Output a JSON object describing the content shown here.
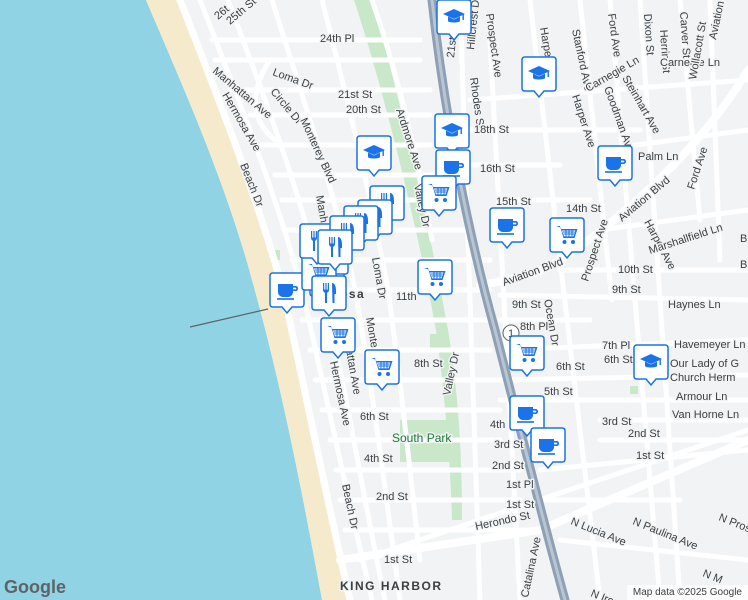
{
  "map": {
    "attribution": "Map data ©2025 Google",
    "logo": "Google",
    "colors": {
      "ocean": "#8fd3e4",
      "beach": "#f5eacb",
      "land": "#f1f3f4",
      "road": "#ffffff",
      "highway": "#8ea0b5",
      "park": "#c9e7c9",
      "pin": "#1a73e8"
    },
    "labels": [
      {
        "id": "26th-st",
        "text": "26t"
      },
      {
        "id": "25th-st",
        "text": "25th St"
      },
      {
        "id": "24th-pl",
        "text": "24th Pl"
      },
      {
        "id": "loma-dr-n",
        "text": "Loma Dr"
      },
      {
        "id": "manhattan-ave-n",
        "text": "Manhattan Ave"
      },
      {
        "id": "circle-dr",
        "text": "Circle Dr"
      },
      {
        "id": "monterey-blvd",
        "text": "Monterey Blvd"
      },
      {
        "id": "21st-st",
        "text": "21st St"
      },
      {
        "id": "20th-st",
        "text": "20th St"
      },
      {
        "id": "hermosa-ave-n",
        "text": "Hermosa Ave"
      },
      {
        "id": "beach-dr-n",
        "text": "Beach Dr"
      },
      {
        "id": "ardmore-ave",
        "text": "Ardmore Ave"
      },
      {
        "id": "valley-dr-n",
        "text": "Valley Dr"
      },
      {
        "id": "manhattan-ave-mid",
        "text": "Manh"
      },
      {
        "id": "loma-dr-s",
        "text": "Loma Dr"
      },
      {
        "id": "11th-st",
        "text": "11th"
      },
      {
        "id": "hermosa-city",
        "text": "osa"
      },
      {
        "id": "monterey-s",
        "text": "Monte"
      },
      {
        "id": "manhattan-ave-s",
        "text": "attan Ave"
      },
      {
        "id": "hermosa-ave-s",
        "text": "Hermosa Ave"
      },
      {
        "id": "8th-st",
        "text": "8th St"
      },
      {
        "id": "6th-st",
        "text": "6th St"
      },
      {
        "id": "4th-st",
        "text": "4th St"
      },
      {
        "id": "2nd-st",
        "text": "2nd St"
      },
      {
        "id": "1st-st",
        "text": "1st St"
      },
      {
        "id": "beach-dr-s",
        "text": "Beach Dr"
      },
      {
        "id": "south-park",
        "text": "South Park"
      },
      {
        "id": "valley-dr-s",
        "text": "Valley Dr"
      },
      {
        "id": "king-harbor",
        "text": "KING HARBOR"
      },
      {
        "id": "prospect-ave-n",
        "text": "Prospect Ave"
      },
      {
        "id": "21st-st-e",
        "text": "21st St"
      },
      {
        "id": "hillcrest-dr",
        "text": "Hillcrest Dr"
      },
      {
        "id": "rhodes-st",
        "text": "Rhodes St"
      },
      {
        "id": "18th-st",
        "text": "18th St"
      },
      {
        "id": "16th-st",
        "text": "16th St"
      },
      {
        "id": "14th-st",
        "text": "14th St"
      },
      {
        "id": "15th-st",
        "text": "15th St"
      },
      {
        "id": "harper-ave-n",
        "text": "Harper Ave"
      },
      {
        "id": "stanford-ave",
        "text": "Stanford Ave"
      },
      {
        "id": "ford-ave-n",
        "text": "Ford Ave"
      },
      {
        "id": "dixon-st",
        "text": "Dixon St"
      },
      {
        "id": "carver-st",
        "text": "Carver St"
      },
      {
        "id": "herrin-st",
        "text": "Herrin St"
      },
      {
        "id": "aviation-blvd-ne",
        "text": "Aviation Blvd"
      },
      {
        "id": "carnegie-ln-n",
        "text": "Carnegie Ln"
      },
      {
        "id": "carnegie-ln",
        "text": "Carnegie Ln"
      },
      {
        "id": "steinhart-ave",
        "text": "Steinhart Ave"
      },
      {
        "id": "goodman-ave",
        "text": "Goodman Ave"
      },
      {
        "id": "harper-ave-m",
        "text": "Harper Ave"
      },
      {
        "id": "wollacott-st",
        "text": "Wollacott St"
      },
      {
        "id": "palm-ln",
        "text": "Palm Ln"
      },
      {
        "id": "aviation-blvd-e",
        "text": "Aviation Blvd"
      },
      {
        "id": "ford-ave-e",
        "text": "Ford Ave"
      },
      {
        "id": "harper-ave-s",
        "text": "Harper Ave"
      },
      {
        "id": "marshallfield-ln",
        "text": "Marshallfield Ln"
      },
      {
        "id": "aviation-blvd-w",
        "text": "Aviation Blvd"
      },
      {
        "id": "10th-st",
        "text": "10th St"
      },
      {
        "id": "9th-st-e",
        "text": "9th St"
      },
      {
        "id": "9th-st",
        "text": "9th St"
      },
      {
        "id": "prospect-ave-s",
        "text": "Prospect Ave"
      },
      {
        "id": "ocean-dr",
        "text": "Ocean Dr"
      },
      {
        "id": "8th-pl",
        "text": "8th Pl"
      },
      {
        "id": "haynes-ln",
        "text": "Haynes Ln"
      },
      {
        "id": "havemeyer-ln",
        "text": "Havemeyer Ln"
      },
      {
        "id": "7th-pl",
        "text": "7th Pl"
      },
      {
        "id": "6th-st-e",
        "text": "6th St"
      },
      {
        "id": "6th-st-m",
        "text": "6th St"
      },
      {
        "id": "5th-st",
        "text": "5th St"
      },
      {
        "id": "church-1",
        "text": "Our Lady of G"
      },
      {
        "id": "church-2",
        "text": "Church Herm"
      },
      {
        "id": "armour-ln",
        "text": "Armour Ln"
      },
      {
        "id": "van-horne-ln",
        "text": "Van Horne Ln"
      },
      {
        "id": "3rd-st-e",
        "text": "3rd St"
      },
      {
        "id": "2nd-st-e",
        "text": "2nd St"
      },
      {
        "id": "1st-st-e",
        "text": "1st St"
      },
      {
        "id": "4th-st-m",
        "text": "4th"
      },
      {
        "id": "3rd-st",
        "text": "3rd St"
      },
      {
        "id": "2nd-st-m",
        "text": "2nd St"
      },
      {
        "id": "1st-pl",
        "text": "1st Pl"
      },
      {
        "id": "1st-st-m",
        "text": "1st St"
      },
      {
        "id": "herondo-st",
        "text": "Herondo St"
      },
      {
        "id": "n-paulina-ave",
        "text": "N Paulina Ave"
      },
      {
        "id": "n-pros",
        "text": "N Pros"
      },
      {
        "id": "n-lucia-ave",
        "text": "N Lucia Ave"
      },
      {
        "id": "catalina-ave",
        "text": "Catalina Ave"
      },
      {
        "id": "n-irena",
        "text": "N Iren"
      },
      {
        "id": "n-m",
        "text": "N M"
      },
      {
        "id": "route-1",
        "text": "1"
      },
      {
        "id": "bl",
        "text": "Bl"
      },
      {
        "id": "b",
        "text": "B"
      }
    ],
    "markers": [
      {
        "id": "school-1",
        "icon": "school-icon"
      },
      {
        "id": "school-2",
        "icon": "school-icon"
      },
      {
        "id": "school-3",
        "icon": "school-icon"
      },
      {
        "id": "school-4",
        "icon": "school-icon"
      },
      {
        "id": "school-5",
        "icon": "school-icon"
      },
      {
        "id": "cafe-1",
        "icon": "coffee-icon"
      },
      {
        "id": "cafe-2",
        "icon": "coffee-icon"
      },
      {
        "id": "cafe-3",
        "icon": "coffee-icon"
      },
      {
        "id": "cafe-4",
        "icon": "coffee-icon"
      },
      {
        "id": "cafe-5",
        "icon": "coffee-icon"
      },
      {
        "id": "cafe-6",
        "icon": "coffee-icon"
      },
      {
        "id": "cafe-7",
        "icon": "coffee-icon"
      },
      {
        "id": "shop-1",
        "icon": "cart-icon"
      },
      {
        "id": "shop-2",
        "icon": "cart-icon"
      },
      {
        "id": "shop-3",
        "icon": "cart-icon"
      },
      {
        "id": "shop-4",
        "icon": "cart-icon"
      },
      {
        "id": "shop-5",
        "icon": "cart-icon"
      },
      {
        "id": "shop-6",
        "icon": "cart-icon"
      },
      {
        "id": "shop-7",
        "icon": "cart-icon"
      },
      {
        "id": "shop-8",
        "icon": "cart-icon"
      },
      {
        "id": "food-1",
        "icon": "utensils-icon"
      },
      {
        "id": "food-2",
        "icon": "utensils-icon"
      },
      {
        "id": "food-3",
        "icon": "utensils-icon"
      },
      {
        "id": "food-4",
        "icon": "utensils-icon"
      },
      {
        "id": "food-5",
        "icon": "utensils-icon"
      },
      {
        "id": "food-6",
        "icon": "utensils-icon"
      },
      {
        "id": "food-7",
        "icon": "utensils-icon"
      }
    ]
  }
}
